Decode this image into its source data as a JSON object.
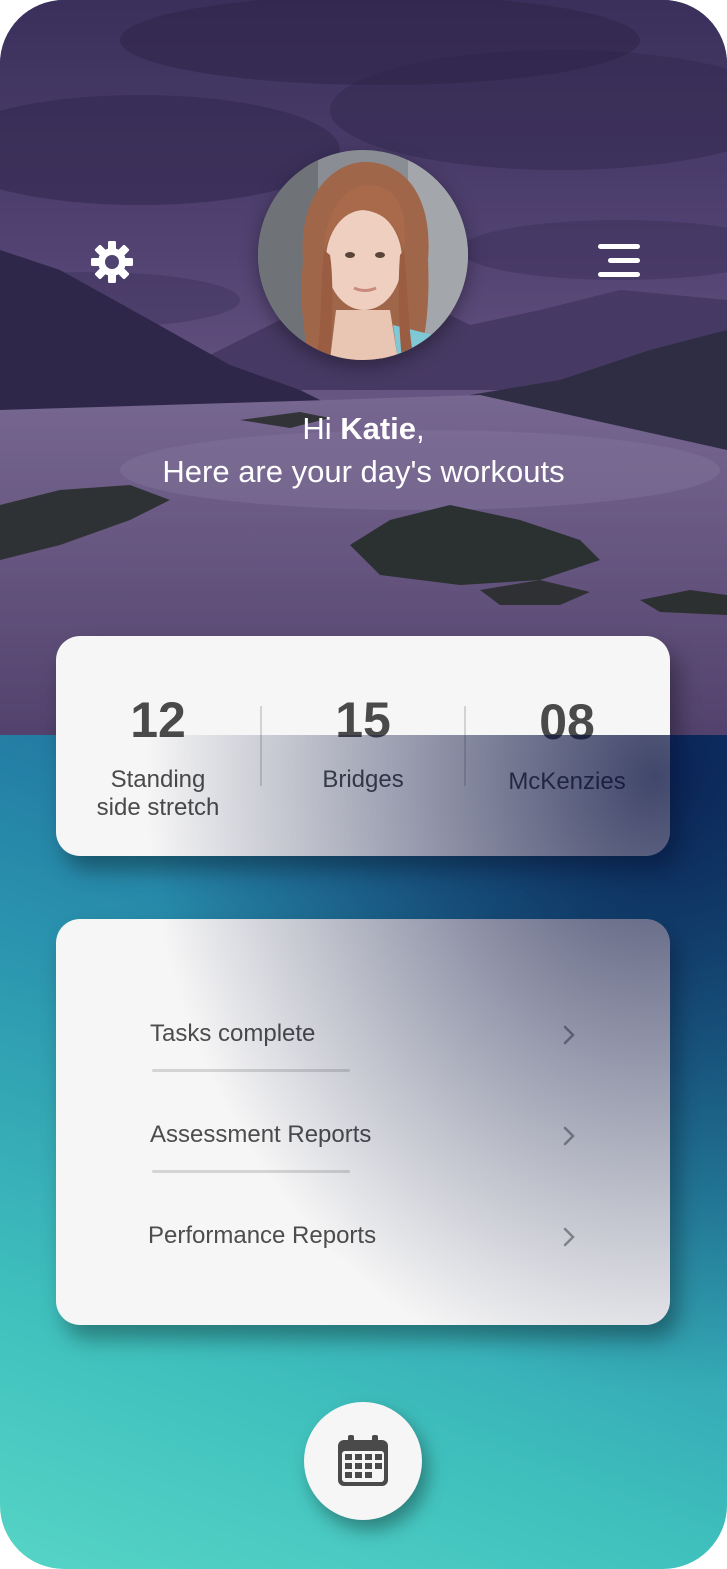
{
  "header": {
    "settings_icon": "gear-icon",
    "menu_icon": "hamburger-menu-icon"
  },
  "greeting": {
    "hi": "Hi ",
    "name": "Katie",
    "comma": ",",
    "subtitle": "Here are your day's workouts"
  },
  "stats": [
    {
      "value": "12",
      "label_line1": "Standing",
      "label_line2": "side stretch"
    },
    {
      "value": "15",
      "label_line1": "Bridges",
      "label_line2": ""
    },
    {
      "value": "08",
      "label_line1": "McKenzies",
      "label_line2": ""
    }
  ],
  "links": [
    {
      "label": "Tasks complete",
      "icon": "chevron-right-icon"
    },
    {
      "label": "Assessment Reports",
      "icon": "chevron-right-icon"
    },
    {
      "label": "Performance Reports",
      "icon": "chevron-right-icon"
    }
  ],
  "fab": {
    "icon": "calendar-icon"
  },
  "colors": {
    "gradient_top": "#061a4e",
    "gradient_bottom": "#56d4c6",
    "card": "#f6f6f6",
    "text": "#4a4a4a",
    "hero_tint": "#4b3a6e"
  }
}
